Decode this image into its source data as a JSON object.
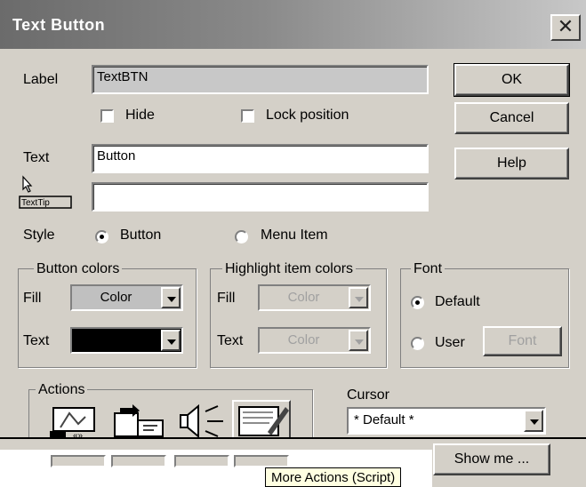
{
  "window": {
    "title": "Text Button",
    "close_glyph": "✕"
  },
  "label_row": {
    "label": "Label",
    "value": "TextBTN"
  },
  "checkboxes": {
    "hide": "Hide",
    "lock_position": "Lock position"
  },
  "text_row": {
    "label": "Text",
    "value": "Button"
  },
  "tooltip_row": {
    "label": "TextTip",
    "value": ""
  },
  "style_row": {
    "label": "Style",
    "option_button": "Button",
    "option_menu_item": "Menu Item",
    "selected": "Button"
  },
  "buttons": {
    "ok": "OK",
    "cancel": "Cancel",
    "help": "Help",
    "show_me": "Show me ..."
  },
  "button_colors": {
    "title": "Button colors",
    "fill_label": "Fill",
    "fill_value": "Color",
    "text_label": "Text",
    "text_color": "#000000"
  },
  "highlight_colors": {
    "title": "Highlight item colors",
    "fill_label": "Fill",
    "fill_value": "Color",
    "text_label": "Text",
    "text_value": "Color"
  },
  "font_group": {
    "title": "Font",
    "default": "Default",
    "user": "User",
    "font_button": "Font",
    "selected": "Default"
  },
  "actions": {
    "title": "Actions",
    "items": [
      "film-projector-icon",
      "jump-page-icon",
      "speaker-icon",
      "script-pencil-icon"
    ]
  },
  "cursor": {
    "label": "Cursor",
    "value": "* Default *"
  },
  "hover_tooltip": "More Actions (Script)"
}
